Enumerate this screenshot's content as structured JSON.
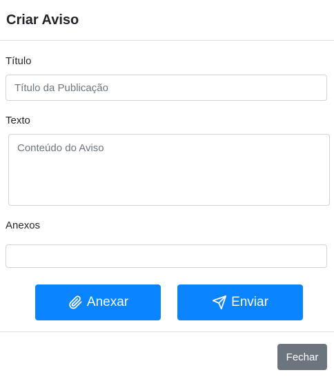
{
  "modal": {
    "title": "Criar Aviso"
  },
  "form": {
    "titulo": {
      "label": "Título",
      "placeholder": "Título da Publicação",
      "value": ""
    },
    "texto": {
      "label": "Texto",
      "placeholder": "Conteúdo do Aviso",
      "value": ""
    },
    "anexos": {
      "label": "Anexos",
      "value": ""
    }
  },
  "actions": {
    "anexar_label": "Anexar",
    "enviar_label": "Enviar",
    "fechar_label": "Fechar"
  },
  "icons": {
    "anexar": "paperclip-icon",
    "enviar": "send-icon"
  },
  "colors": {
    "primary": "#0a84ff",
    "secondary": "#6c757d",
    "border": "#ced4da",
    "divider": "#dee2e6"
  }
}
